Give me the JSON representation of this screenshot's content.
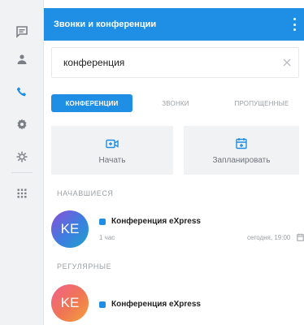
{
  "rail": {
    "items": [
      {
        "name": "chats-icon"
      },
      {
        "name": "contacts-icon"
      },
      {
        "name": "calls-icon"
      },
      {
        "name": "settings-icon"
      },
      {
        "name": "extensions-icon"
      },
      {
        "name": "apps-grid-icon"
      }
    ],
    "active_color": "#1f8ee5"
  },
  "header": {
    "title": "Звонки и конференции"
  },
  "search": {
    "value": "конференция"
  },
  "tabs": [
    {
      "label": "КОНФЕРЕНЦИИ",
      "active": true
    },
    {
      "label": "ЗВОНКИ",
      "active": false
    },
    {
      "label": "ПРОПУЩЕННЫЕ",
      "active": false
    }
  ],
  "actions": {
    "start_label": "Начать",
    "schedule_label": "Запланировать"
  },
  "sections": {
    "started": "НАЧАВШИЕСЯ",
    "regular": "РЕГУЛЯРНЫЕ"
  },
  "conferences": [
    {
      "initials": "KE",
      "title": "Конференция eXpress",
      "duration": "1 час",
      "time": "сегодня, 19:00"
    },
    {
      "initials": "KE",
      "title": "Конференция eXpress"
    }
  ],
  "colors": {
    "accent": "#1f8ee5",
    "rail_bg": "#f1f2f4"
  }
}
